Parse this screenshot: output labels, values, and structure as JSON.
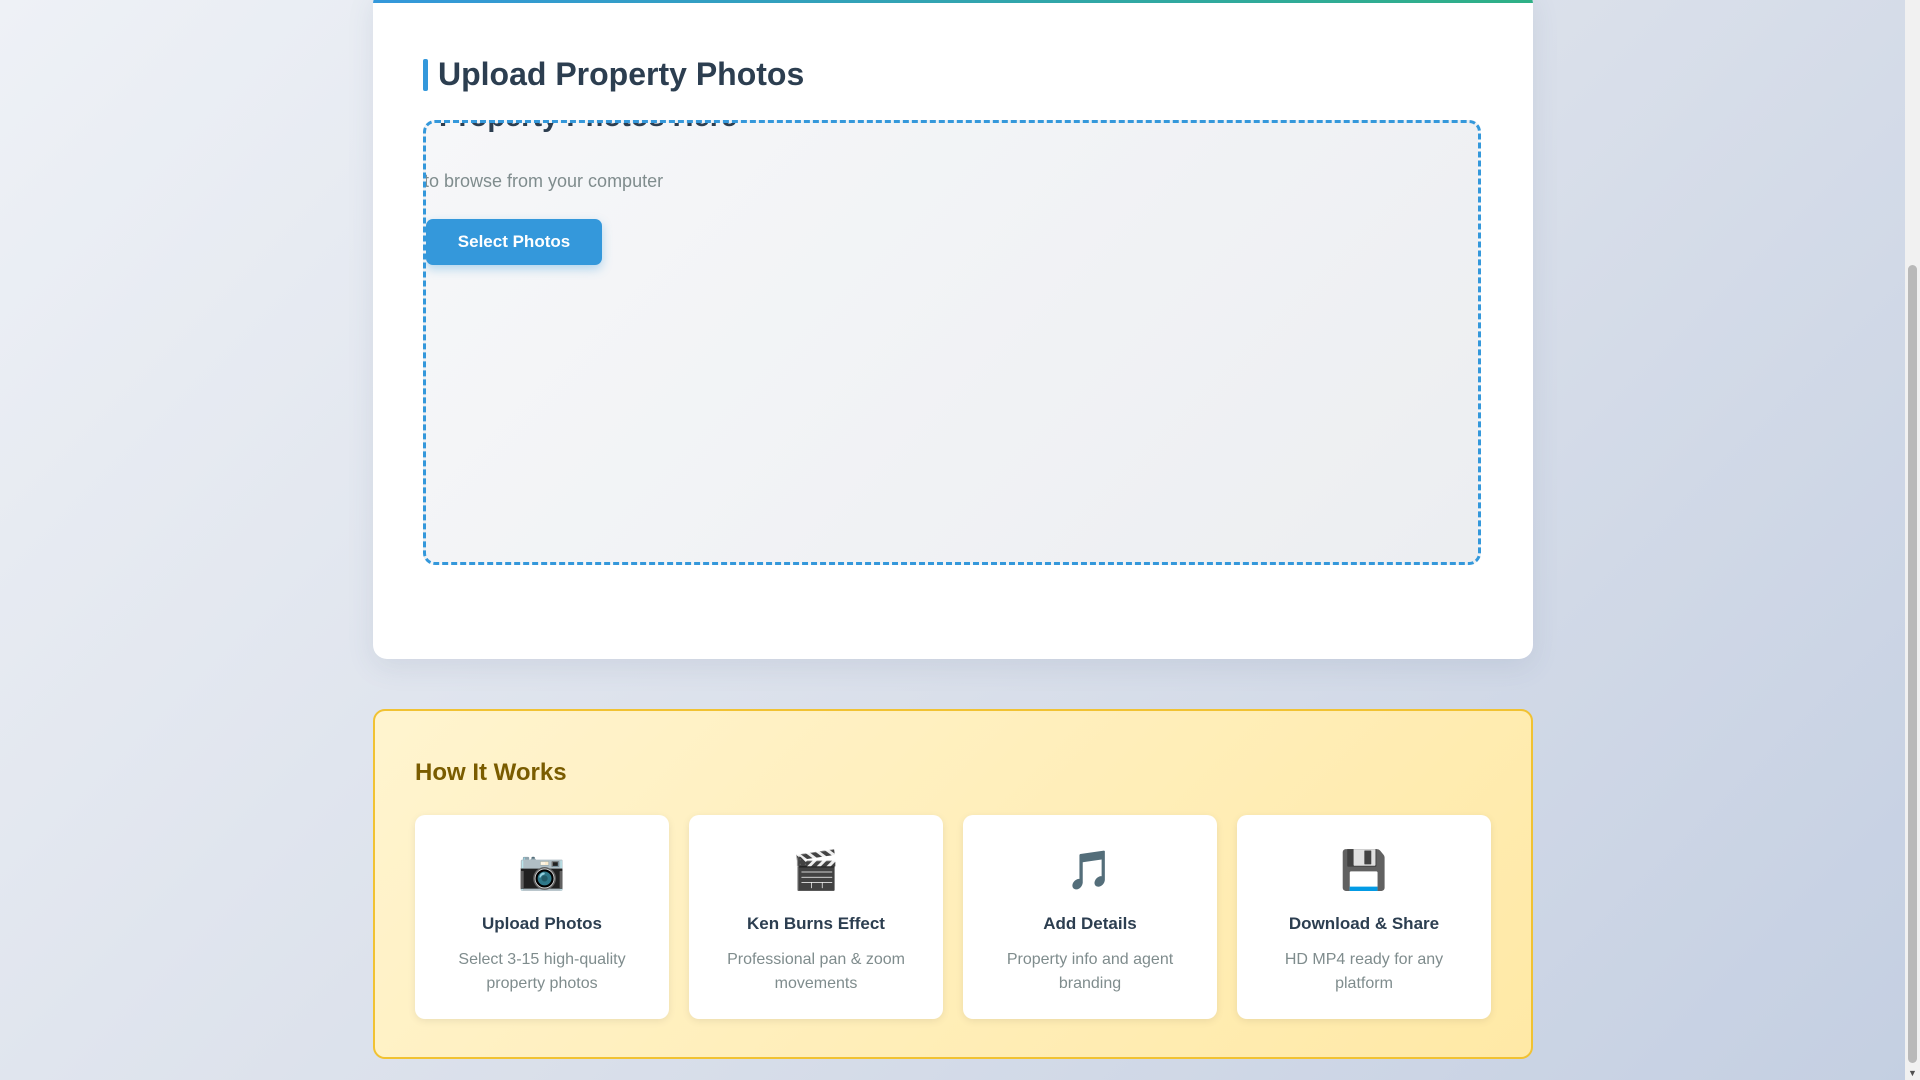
{
  "upload_section": {
    "title": "Upload Property Photos",
    "drop_title": "Property Photos Here",
    "drop_subtitle": "to browse from your computer",
    "select_button": "Select Photos"
  },
  "how_it_works": {
    "title": "How It Works",
    "steps": [
      {
        "icon": "camera-icon",
        "glyph": "📷",
        "title": "Upload Photos",
        "description": "Select 3-15 high-quality property photos"
      },
      {
        "icon": "clapper-board-icon",
        "glyph": "🎬",
        "title": "Ken Burns Effect",
        "description": "Professional pan & zoom movements"
      },
      {
        "icon": "music-note-icon",
        "glyph": "🎵",
        "title": "Add Details",
        "description": "Property info and agent branding"
      },
      {
        "icon": "floppy-disk-icon",
        "glyph": "💾",
        "title": "Download & Share",
        "description": "HD MP4 ready for any platform"
      }
    ]
  },
  "colors": {
    "accent": "#3498db",
    "accent_green": "#2fb086",
    "how_border": "#f1c232",
    "how_title": "#7a5c00"
  },
  "scrollbar": {
    "down_arrow": "▼"
  }
}
